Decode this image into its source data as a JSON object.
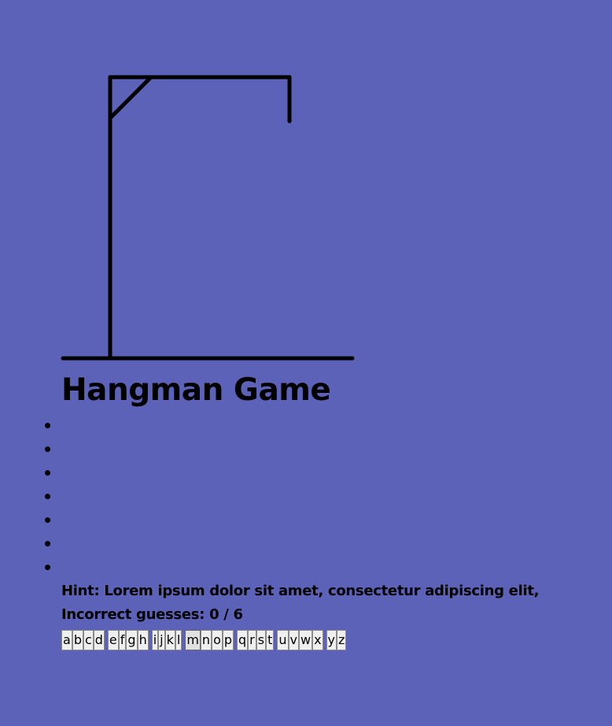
{
  "game": {
    "title": "Hangman Game",
    "word_slots": [
      "",
      "",
      "",
      "",
      "",
      "",
      ""
    ],
    "hint_label": "Hint:",
    "hint_text": "Lorem ipsum dolor sit amet, consectetur adipiscing elit,",
    "guesses_label": "Incorrect guesses:",
    "guesses_value": "0 / 6"
  },
  "keyboard": {
    "letters": [
      "a",
      "b",
      "c",
      "d",
      "e",
      "f",
      "g",
      "h",
      "i",
      "j",
      "k",
      "l",
      "m",
      "n",
      "o",
      "p",
      "q",
      "r",
      "s",
      "t",
      "u",
      "v",
      "w",
      "x",
      "y",
      "z"
    ],
    "focused_letter": "m"
  },
  "colors": {
    "background": "#5c62b8",
    "ink": "#000000",
    "key_face": "#efefef"
  }
}
